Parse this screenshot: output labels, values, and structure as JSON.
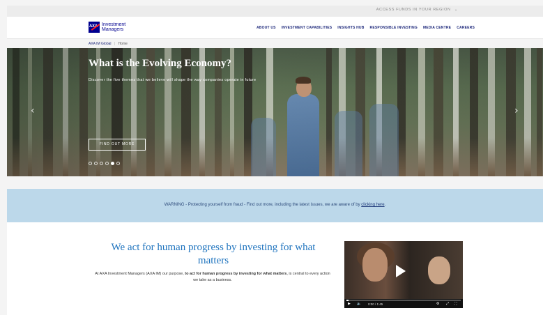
{
  "topbar": {
    "region_label": "ACCESS FUNDS IN YOUR REGION",
    "region_chevron": "chevron-down-icon"
  },
  "brand": {
    "logo_mark": "AXA",
    "name_line1": "Investment",
    "name_line2": "Managers"
  },
  "nav": {
    "items": [
      {
        "label": "ABOUT US"
      },
      {
        "label": "INVESTMENT CAPABILITIES"
      },
      {
        "label": "INSIGHTS HUB"
      },
      {
        "label": "RESPONSIBLE INVESTING"
      },
      {
        "label": "MEDIA CENTRE"
      },
      {
        "label": "CAREERS"
      }
    ]
  },
  "breadcrumb": {
    "root": "AXA IM Global",
    "separator": "|",
    "current": "Home"
  },
  "hero": {
    "title": "What is the Evolving Economy?",
    "subtitle": "Discover the five themes that we believe will shape the way companies operate in future",
    "cta": "FIND OUT MORE",
    "slides_total": 6,
    "active_slide": 5,
    "prev_icon": "chevron-left-icon",
    "next_icon": "chevron-right-icon"
  },
  "warning": {
    "prefix": "WARNING",
    "text": " - Protecting yourself from fraud - Find out more, including the latest issues, we are aware of by ",
    "link": "clicking here",
    "suffix": "."
  },
  "main": {
    "headline": "We act for human progress by investing for what matters",
    "para_pre": "At AXA Investment Managers (AXA IM) our purpose, ",
    "para_bold": "to act for human progress by investing for what matters",
    "para_post": ", is central to every action we take as a business."
  },
  "video": {
    "time": "0:00 / 1:45",
    "progress": 0.02,
    "icons": [
      "play-icon",
      "volume-icon",
      "settings-icon",
      "fullscreen-icon"
    ]
  },
  "colors": {
    "brand_blue": "#00008f",
    "accent_red": "#ff1721",
    "headline_blue": "#1e73be",
    "warning_bg": "#bcd8ea"
  }
}
